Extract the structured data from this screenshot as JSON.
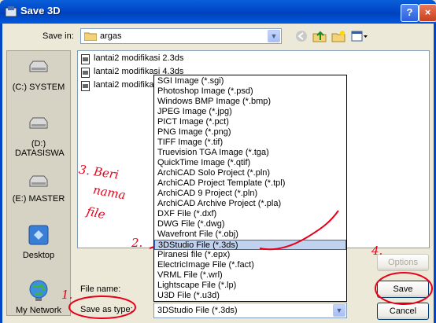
{
  "window": {
    "title": "Save 3D",
    "help_label": "?",
    "close_label": "×"
  },
  "save_in": {
    "label": "Save in:",
    "value": "argas"
  },
  "places": [
    {
      "label": "(C:) SYSTEM",
      "icon": "hard-drive-icon"
    },
    {
      "label": "(D:) DATASISWA",
      "icon": "hard-drive-icon"
    },
    {
      "label": "(E:) MASTER",
      "icon": "hard-drive-icon"
    },
    {
      "label": "Desktop",
      "icon": "desktop-icon"
    },
    {
      "label": "My Network",
      "icon": "network-globe-icon"
    }
  ],
  "files": [
    "lantai2 modifikasi 2.3ds",
    "lantai2 modifikasi 4.3ds",
    "lantai2 modifikasi"
  ],
  "file_types": [
    "SGI Image (*.sgi)",
    "Photoshop Image (*.psd)",
    "Windows BMP Image (*.bmp)",
    "JPEG Image (*.jpg)",
    "PICT Image (*.pct)",
    "PNG Image (*.png)",
    "TIFF Image (*.tif)",
    "Truevision TGA Image (*.tga)",
    "QuickTime Image (*.qtif)",
    "ArchiCAD Solo Project (*.pln)",
    "ArchiCAD Project Template (*.tpl)",
    "ArchiCAD 9 Project (*.pln)",
    "ArchiCAD Archive Project (*.pla)",
    "DXF File (*.dxf)",
    "DWG File (*.dwg)",
    "Wavefront File (*.obj)",
    "3DStudio File (*.3ds)",
    "Piranesi file (*.epx)",
    "ElectricImage File (*.fact)",
    "VRML File (*.wrl)",
    "Lightscape File (*.lp)",
    "U3D File (*.u3d)"
  ],
  "selected_type": "3DStudio File (*.3ds)",
  "filename_label": "File name:",
  "savetype_label": "Save as type:",
  "buttons": {
    "options": "Options",
    "save": "Save",
    "cancel": "Cancel"
  },
  "annotations": {
    "step1": "1.",
    "step2": "2.",
    "step3_line1": "3. Beri",
    "step3_line2": "nama",
    "step3_line3": "file",
    "step4": "4."
  },
  "colors": {
    "titlebar": "#0047c8",
    "selection": "#c1d2ee",
    "annotation": "#e8001a"
  }
}
